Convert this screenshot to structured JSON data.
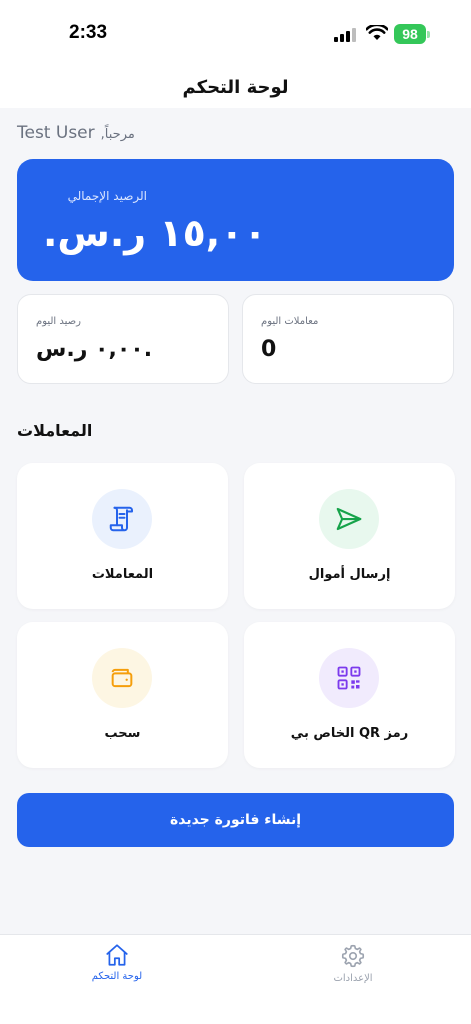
{
  "status_bar": {
    "time": "2:33",
    "battery": "98"
  },
  "header": {
    "title": "لوحة التحكم"
  },
  "greeting": {
    "hello": "مرحباً,",
    "user": "Test User"
  },
  "balance": {
    "label": "الرصيد الإجمالي",
    "amount": "١٥,٠٠ ر.س."
  },
  "stats": {
    "today_balance": {
      "label": "رصيد اليوم",
      "value": "٠,٠٠ ر.س."
    },
    "today_transactions": {
      "label": "معاملات اليوم",
      "value": "0"
    }
  },
  "section": {
    "title": "المعاملات"
  },
  "actions": [
    {
      "label": "إرسال أموال",
      "icon": "send-icon",
      "color": "#16a34a",
      "bg": "#e8f8ee"
    },
    {
      "label": "المعاملات",
      "icon": "receipt-icon",
      "color": "#2563eb",
      "bg": "#eaf1fd"
    },
    {
      "label": "رمز QR الخاص بي",
      "icon": "qr-code-icon",
      "color": "#7c3aed",
      "bg": "#f1ebfd"
    },
    {
      "label": "سحب",
      "icon": "wallet-icon",
      "color": "#f59e0b",
      "bg": "#fdf6e3"
    }
  ],
  "cta": {
    "label": "إنشاء فاتورة جديدة"
  },
  "tabs": {
    "home": {
      "label": "لوحة التحكم",
      "icon": "home-icon"
    },
    "settings": {
      "label": "الإعدادات",
      "icon": "gear-icon"
    }
  },
  "colors": {
    "primary": "#2563eb",
    "background": "#f5f6f9"
  }
}
